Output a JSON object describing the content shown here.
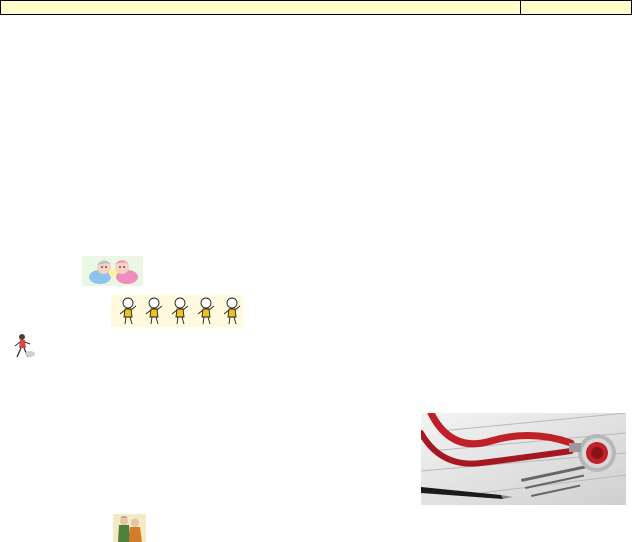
{
  "header": {
    "cell_1": "",
    "cell_2": ""
  },
  "colors": {
    "header_fill": "#ffffcc",
    "header_border": "#000000",
    "stethoscope_red": "#c0202a"
  },
  "illustrations": {
    "babies": "two-babies-clipart",
    "kids": "five-children-clipart",
    "walker": "person-walking-clipart",
    "medical": "stethoscope-medical-form-photo",
    "couple": "elderly-couple-clipart"
  }
}
